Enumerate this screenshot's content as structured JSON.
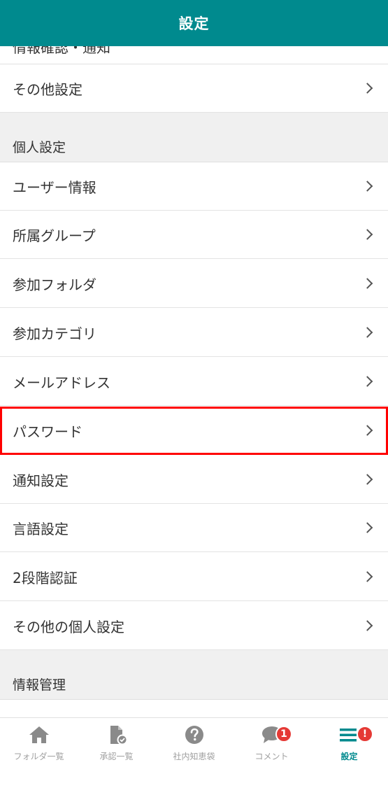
{
  "header": {
    "title": "設定"
  },
  "partial_row": {
    "label": "情報確認・通知"
  },
  "rows_top": [
    {
      "label": "その他設定"
    }
  ],
  "sections": {
    "personal": "個人設定",
    "info_management": "情報管理"
  },
  "personal_rows": [
    {
      "label": "ユーザー情報"
    },
    {
      "label": "所属グループ"
    },
    {
      "label": "参加フォルダ"
    },
    {
      "label": "参加カテゴリ"
    },
    {
      "label": "メールアドレス"
    },
    {
      "label": "パスワード"
    },
    {
      "label": "通知設定"
    },
    {
      "label": "言語設定"
    },
    {
      "label": "2段階認証"
    },
    {
      "label": "その他の個人設定"
    }
  ],
  "tabbar": {
    "tabs": [
      {
        "label": "フォルダ一覧",
        "icon": "home-icon"
      },
      {
        "label": "承認一覧",
        "icon": "document-check-icon"
      },
      {
        "label": "社内知恵袋",
        "icon": "question-icon"
      },
      {
        "label": "コメント",
        "icon": "comment-icon",
        "badge": "1"
      },
      {
        "label": "設定",
        "icon": "menu-icon",
        "badge": "!"
      }
    ]
  },
  "colors": {
    "accent": "#008a8e",
    "highlight": "#ff0000",
    "badge": "#e53935"
  }
}
